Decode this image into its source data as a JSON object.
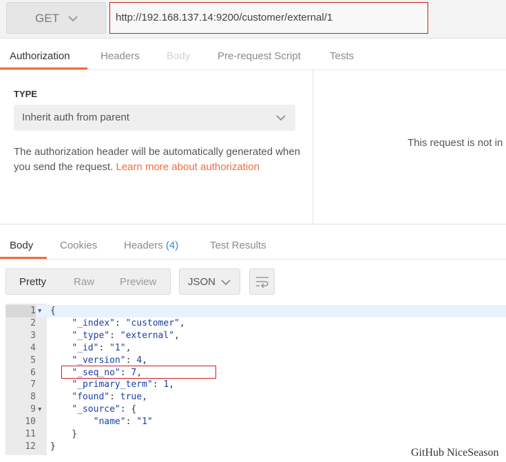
{
  "request": {
    "method": "GET",
    "url": "http://192.168.137.14:9200/customer/external/1"
  },
  "request_tabs": [
    {
      "label": "Authorization",
      "state": "active"
    },
    {
      "label": "Headers",
      "state": "normal"
    },
    {
      "label": "Body",
      "state": "disabled"
    },
    {
      "label": "Pre-request Script",
      "state": "normal"
    },
    {
      "label": "Tests",
      "state": "normal"
    }
  ],
  "auth": {
    "type_label": "TYPE",
    "type_value": "Inherit auth from parent",
    "description": "The authorization header will be automatically generated when you send the request.",
    "link_text": "Learn more about authorization"
  },
  "right_panel": {
    "message": "This request is not in"
  },
  "response_tabs": [
    {
      "label": "Body",
      "state": "active"
    },
    {
      "label": "Cookies",
      "state": "normal"
    },
    {
      "label": "Headers",
      "count": "(4)",
      "state": "normal"
    },
    {
      "label": "Test Results",
      "state": "normal"
    }
  ],
  "view_modes": [
    "Pretty",
    "Raw",
    "Preview"
  ],
  "active_view": "Pretty",
  "format": "JSON",
  "colors": {
    "accent": "#f26b3a",
    "highlight_border": "#d11a1a",
    "json_value": "#1a3ea8",
    "link_count": "#2a8dd4"
  },
  "code_lines": [
    {
      "n": "1",
      "fold": true,
      "text": "{"
    },
    {
      "n": "2",
      "text": "    \"_index\": \"customer\","
    },
    {
      "n": "3",
      "text": "    \"_type\": \"external\","
    },
    {
      "n": "4",
      "text": "    \"_id\": \"1\","
    },
    {
      "n": "5",
      "text": "    \"_version\": 4,"
    },
    {
      "n": "6",
      "text": "    \"_seq_no\": 7,"
    },
    {
      "n": "7",
      "text": "    \"_primary_term\": 1,"
    },
    {
      "n": "8",
      "text": "    \"found\": true,"
    },
    {
      "n": "9",
      "fold": true,
      "text": "    \"_source\": {"
    },
    {
      "n": "10",
      "text": "        \"name\": \"1\""
    },
    {
      "n": "11",
      "text": "    }"
    },
    {
      "n": "12",
      "text": "}"
    }
  ],
  "watermark": "GitHub NiceSeason"
}
